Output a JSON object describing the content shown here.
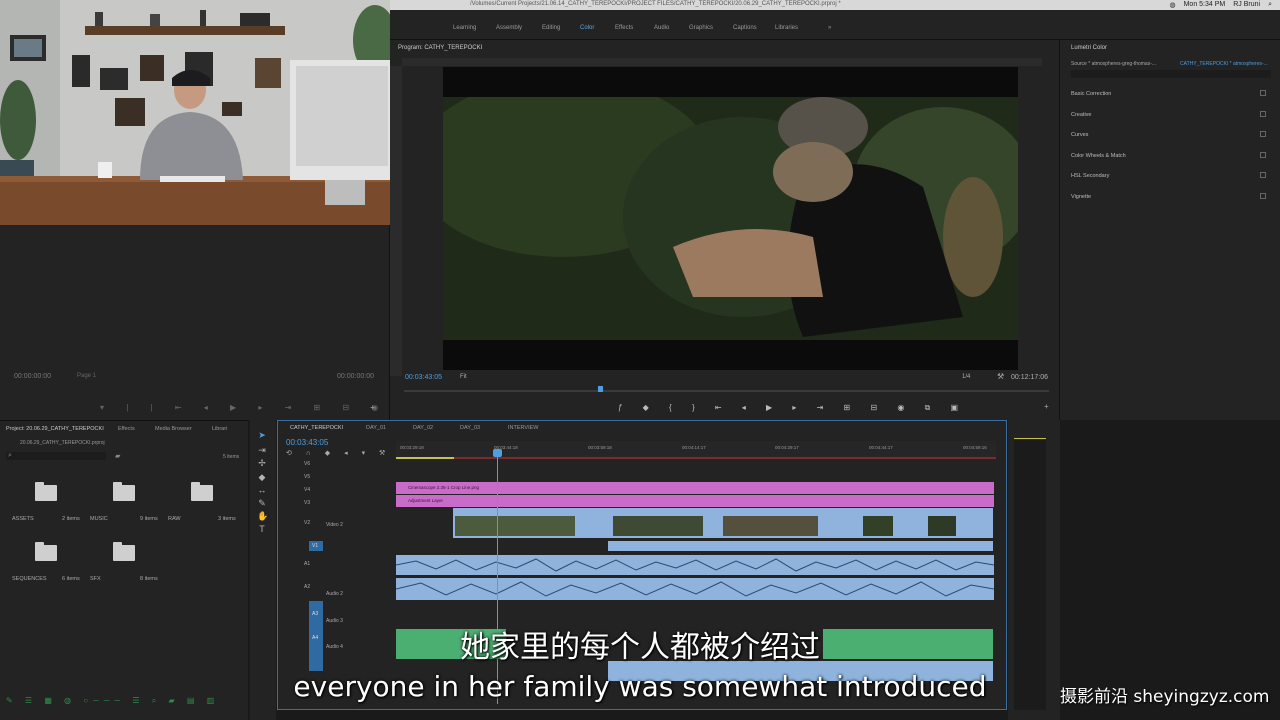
{
  "menubar": {
    "title": "/Volumes/Current Projects/21.06.14_CATHY_TEREPOCKI/PROJECT FILES/CATHY_TEREPOCKI/20.06.29_CATHY_TEREPOCKI.prproj *",
    "time": "Mon 5:34 PM",
    "user": "RJ Bruni"
  },
  "workspaces": [
    "Learning",
    "Assembly",
    "Editing",
    "Color",
    "Effects",
    "Audio",
    "Graphics",
    "Captions",
    "Libraries"
  ],
  "active_workspace": "Color",
  "source": {
    "tc_left": "00:00:00:00",
    "page": "Page 1",
    "tc_right": "00:00:00:00"
  },
  "program": {
    "tab": "Program: CATHY_TEREPOCKI",
    "timecode": "00:03:43:05",
    "fit": "Fit",
    "res": "1/4",
    "duration": "00:12:17:06"
  },
  "lumetri": {
    "tab": "Lumetri Color",
    "source": "Source * atmospheres-greg-thomas-...",
    "seq": "CATHY_TEREPOCKI * atmospheres-...",
    "sections": [
      "Basic Correction",
      "Creative",
      "Curves",
      "Color Wheels & Match",
      "HSL Secondary",
      "Vignette"
    ]
  },
  "project": {
    "tabs": [
      "Project: 20.06.29_CATHY_TEREPOCKI",
      "Effects",
      "Media Browser",
      "Librari"
    ],
    "file": "20.06.29_CATHY_TEREPOCKI.prproj",
    "count": "5 items",
    "folders": [
      {
        "name": "ASSETS",
        "items": "2 items"
      },
      {
        "name": "MUSIC",
        "items": "9 items"
      },
      {
        "name": "RAW",
        "items": "3 items"
      },
      {
        "name": "SEQUENCES",
        "items": "6 items"
      },
      {
        "name": "SFX",
        "items": "8 items"
      }
    ]
  },
  "timeline": {
    "tabs": [
      "CATHY_TEREPOCKI",
      "DAY_01",
      "DAY_02",
      "DAY_03",
      "INTERVIEW"
    ],
    "timecode": "00:03:43:05",
    "ruler": [
      "00:03:29:18",
      "00:03:44:18",
      "00:03:59:18",
      "00:04:14:17",
      "00:04:29:17",
      "00:04:44:17",
      "00:04:59:16"
    ],
    "tracks_v": [
      "V6",
      "V5",
      "V4",
      "V3",
      "V2",
      "V1"
    ],
    "track_v2_name": "Video 2",
    "tracks_a": [
      "A1",
      "A2",
      "A3",
      "A4"
    ],
    "track_a2_name": "Audio 2",
    "track_a3_name": "Audio 3",
    "track_a4_name": "Audio 4",
    "clip_overlay": "Cinemascope 2.35-1 Crop Line.png",
    "clip_adjust": "Adjustment Layer"
  },
  "subtitles": {
    "cn": "她家里的每个人都被介绍过",
    "en": "everyone in her family was somewhat introduced"
  },
  "watermark": "摄影前沿 sheyingzyz.com"
}
